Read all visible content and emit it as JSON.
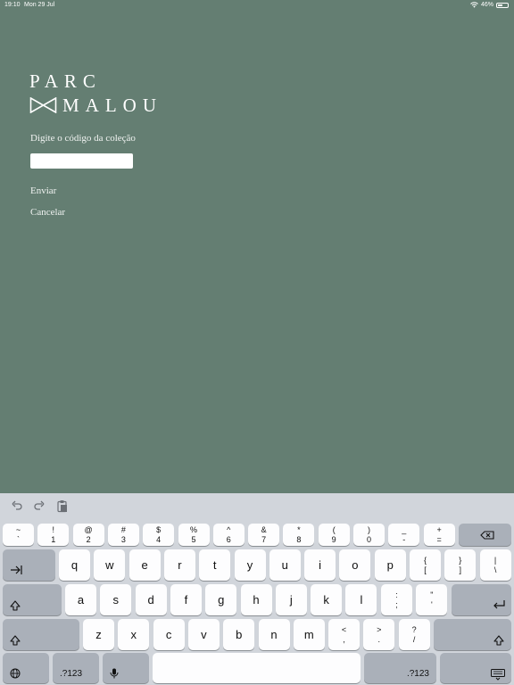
{
  "status": {
    "time": "19:10",
    "date": "Mon 29 Jul",
    "battery": "46%",
    "battery_level": 0.46
  },
  "logo": {
    "line1": "PARC",
    "line2": "MALOU"
  },
  "form": {
    "prompt": "Digite o código da coleção",
    "input_value": "",
    "send_label": "Enviar",
    "cancel_label": "Cancelar"
  },
  "keyboard": {
    "toolbar": [
      "undo-icon",
      "redo-icon",
      "paste-icon"
    ],
    "number_row": [
      {
        "top": "~",
        "bottom": "`"
      },
      {
        "top": "!",
        "bottom": "1"
      },
      {
        "top": "@",
        "bottom": "2"
      },
      {
        "top": "#",
        "bottom": "3"
      },
      {
        "top": "$",
        "bottom": "4"
      },
      {
        "top": "%",
        "bottom": "5"
      },
      {
        "top": "^",
        "bottom": "6"
      },
      {
        "top": "&",
        "bottom": "7"
      },
      {
        "top": "*",
        "bottom": "8"
      },
      {
        "top": "(",
        "bottom": "9"
      },
      {
        "top": ")",
        "bottom": "0"
      },
      {
        "top": "_",
        "bottom": "-"
      },
      {
        "top": "+",
        "bottom": "="
      }
    ],
    "row_q": [
      "q",
      "w",
      "e",
      "r",
      "t",
      "y",
      "u",
      "i",
      "o",
      "p"
    ],
    "row_q_extra": [
      {
        "top": "{",
        "bottom": "["
      },
      {
        "top": "}",
        "bottom": "]"
      },
      {
        "top": "|",
        "bottom": "\\"
      }
    ],
    "row_a": [
      "a",
      "s",
      "d",
      "f",
      "g",
      "h",
      "j",
      "k",
      "l"
    ],
    "row_a_extra": [
      {
        "top": ":",
        "bottom": ";"
      },
      {
        "top": "\"",
        "bottom": "'"
      }
    ],
    "row_z": [
      "z",
      "x",
      "c",
      "v",
      "b",
      "n",
      "m"
    ],
    "row_z_extra": [
      {
        "top": "<",
        "bottom": ","
      },
      {
        "top": ">",
        "bottom": "."
      },
      {
        "top": "?",
        "bottom": "/"
      }
    ],
    "numbers_label": ".?123"
  }
}
